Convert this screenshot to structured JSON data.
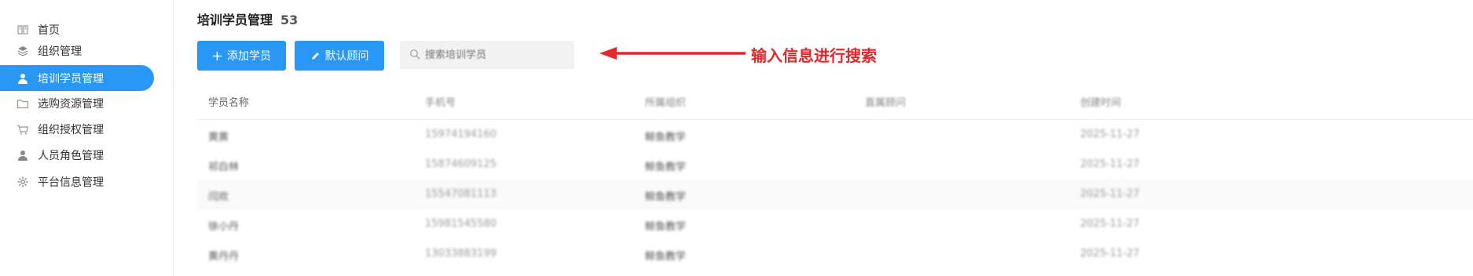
{
  "sidebar": {
    "items": [
      {
        "label": "首页",
        "icon": "book-icon"
      },
      {
        "label": "组织管理",
        "icon": "layers-icon"
      },
      {
        "label": "培训学员管理",
        "icon": "user-icon",
        "active": true
      },
      {
        "label": "选购资源管理",
        "icon": "folder-icon"
      },
      {
        "label": "组织授权管理",
        "icon": "cart-icon"
      },
      {
        "label": "人员角色管理",
        "icon": "user-icon"
      },
      {
        "label": "平台信息管理",
        "icon": "gear-icon"
      }
    ]
  },
  "header": {
    "title": "培训学员管理",
    "count": "53"
  },
  "toolbar": {
    "add_label": "添加学员",
    "default_label": "默认顾问",
    "search_placeholder": "搜索培训学员"
  },
  "annotation": {
    "text": "输入信息进行搜索",
    "color": "#e5262a"
  },
  "table": {
    "columns": [
      "学员名称",
      "手机号",
      "所属组织",
      "直属顾问",
      "创建时间"
    ],
    "rows": [
      [
        "黄黄",
        "15974194160",
        "鲸鱼教学",
        "",
        "2025-11-27"
      ],
      [
        "祁白林",
        "15874609125",
        "鲸鱼教学",
        "",
        "2025-11-27"
      ],
      [
        "闫欢",
        "15547081113",
        "鲸鱼教学",
        "",
        "2025-11-27"
      ],
      [
        "徐小丹",
        "15981545580",
        "鲸鱼教学",
        "",
        "2025-11-27"
      ],
      [
        "黄丹丹",
        "13033883199",
        "鲸鱼教学",
        "",
        "2025-11-27"
      ]
    ]
  },
  "colors": {
    "accent": "#2997f5",
    "annotation": "#e5262a"
  }
}
